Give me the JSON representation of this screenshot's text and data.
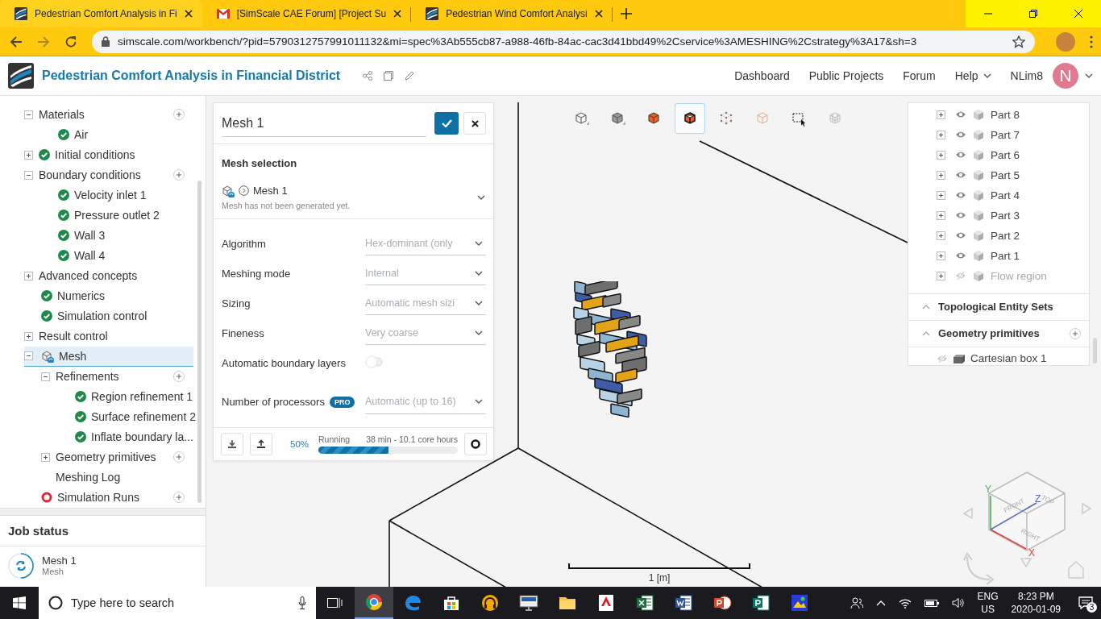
{
  "browser": {
    "tabs": [
      {
        "title": "Pedestrian Comfort Analysis in Fi",
        "kind": "app",
        "selected": true
      },
      {
        "title": "[SimScale CAE Forum] [Project Su",
        "kind": "mail",
        "selected": false
      },
      {
        "title": "Pedestrian Wind Comfort Analysi",
        "kind": "app",
        "selected": false
      }
    ],
    "url": "simscale.com/workbench/?pid=5790312757991011132&mi=spec%3Ab555cb87-a988-46fb-84ac-cac3d41bbd49%2Cservice%3AMESHING%2Cstrategy%3A17&sh=3"
  },
  "header": {
    "title": "Pedestrian Comfort Analysis in Financial District",
    "nav": [
      "Dashboard",
      "Public Projects",
      "Forum"
    ],
    "help": "Help",
    "user": "NLim8",
    "avatar": "N"
  },
  "tree": {
    "items": [
      {
        "label": "Materials",
        "kind": "plain",
        "expanded": true,
        "addable": true,
        "selected": false,
        "children": [
          {
            "label": "Air",
            "kind": "valid",
            "selected": false
          }
        ]
      },
      {
        "label": "Initial conditions",
        "kind": "valid",
        "expanded": false,
        "selected": false
      },
      {
        "label": "Boundary conditions",
        "kind": "plain",
        "expanded": true,
        "addable": true,
        "selected": false,
        "children": [
          {
            "label": "Velocity inlet 1",
            "kind": "valid",
            "selected": false
          },
          {
            "label": "Pressure outlet 2",
            "kind": "valid",
            "selected": false
          },
          {
            "label": "Wall 3",
            "kind": "valid",
            "selected": false
          },
          {
            "label": "Wall 4",
            "kind": "valid",
            "selected": false
          }
        ]
      },
      {
        "label": "Advanced concepts",
        "kind": "plain",
        "expanded": false,
        "selected": false
      },
      {
        "label": "Numerics",
        "kind": "valid",
        "selected": false
      },
      {
        "label": "Simulation control",
        "kind": "valid",
        "selected": false
      },
      {
        "label": "Result control",
        "kind": "plain",
        "expanded": false,
        "selected": false
      },
      {
        "label": "Mesh",
        "kind": "mesh",
        "expanded": true,
        "selected": true,
        "children": [
          {
            "label": "Refinements",
            "kind": "plain",
            "expanded": true,
            "addable": true,
            "selected": false,
            "children": [
              {
                "label": "Region refinement 1",
                "kind": "valid",
                "selected": false
              },
              {
                "label": "Surface refinement 2",
                "kind": "valid",
                "selected": false
              },
              {
                "label": "Inflate boundary la...",
                "kind": "valid",
                "selected": false
              }
            ]
          },
          {
            "label": "Geometry primitives",
            "kind": "plain",
            "expanded": false,
            "addable": true,
            "selected": false
          },
          {
            "label": "Meshing Log",
            "kind": "plain",
            "selected": false
          }
        ]
      },
      {
        "label": "Simulation Runs",
        "kind": "invalid",
        "addable": true,
        "selected": false
      }
    ]
  },
  "job_status": {
    "title": "Job status",
    "jobs": [
      {
        "name": "Mesh 1",
        "type": "Mesh"
      }
    ]
  },
  "mesh_panel": {
    "name": "Mesh 1",
    "section_title": "Mesh selection",
    "selection": {
      "name": "Mesh 1",
      "note": "Mesh has not been generated yet."
    },
    "settings": [
      {
        "kind": "select",
        "label": "Algorithm",
        "value": "Hex-dominant (only"
      },
      {
        "kind": "select",
        "label": "Meshing mode",
        "value": "Internal"
      },
      {
        "kind": "select",
        "label": "Sizing",
        "value": "Automatic mesh sizi"
      },
      {
        "kind": "select",
        "label": "Fineness",
        "value": "Very coarse"
      },
      {
        "kind": "toggle",
        "label": "Automatic boundary layers",
        "on": false
      },
      {
        "kind": "select",
        "label": "Number of processors",
        "badge": "PRO",
        "value": "Automatic (up to 16)"
      }
    ],
    "progress": {
      "percent": "50%",
      "status": "Running",
      "estimate": "38 min - 10.1 core hours",
      "level": 0.5
    }
  },
  "view_tools": [
    {
      "selected": false
    },
    {
      "selected": false
    },
    {
      "selected": false
    },
    {
      "selected": true
    },
    {
      "selected": false
    },
    {
      "selected": false
    },
    {
      "selected": false
    },
    {
      "selected": false
    }
  ],
  "scene_tree": {
    "parts": [
      {
        "label": "Part 8",
        "visible": true
      },
      {
        "label": "Part 7",
        "visible": true
      },
      {
        "label": "Part 6",
        "visible": true
      },
      {
        "label": "Part 5",
        "visible": true
      },
      {
        "label": "Part 4",
        "visible": true
      },
      {
        "label": "Part 3",
        "visible": true
      },
      {
        "label": "Part 2",
        "visible": true
      },
      {
        "label": "Part 1",
        "visible": true
      },
      {
        "label": "Flow region",
        "visible": false
      }
    ],
    "sections": [
      {
        "title": "Topological Entity Sets",
        "expanded": true,
        "addable": false
      },
      {
        "title": "Geometry primitives",
        "expanded": true,
        "addable": true,
        "children": [
          {
            "label": "Cartesian box 1",
            "visible": false
          }
        ]
      }
    ]
  },
  "scale": "1 [m]",
  "view_cube": {
    "faces": [
      "FRONT",
      "TOP",
      "RIGHT"
    ],
    "axes": [
      "X",
      "Y",
      "Z"
    ]
  },
  "taskbar": {
    "search_placeholder": "Type here to search",
    "apps": [
      {
        "active": true
      },
      {
        "active": false
      },
      {
        "active": false
      },
      {
        "active": false
      },
      {
        "active": false
      },
      {
        "active": false
      },
      {
        "active": false
      },
      {
        "active": false
      },
      {
        "active": false
      },
      {
        "active": false
      },
      {
        "active": false
      },
      {
        "active": false
      }
    ],
    "language": "ENG",
    "region": "US",
    "time": "8:23 PM",
    "date": "2020-01-09",
    "notifications": "3"
  }
}
